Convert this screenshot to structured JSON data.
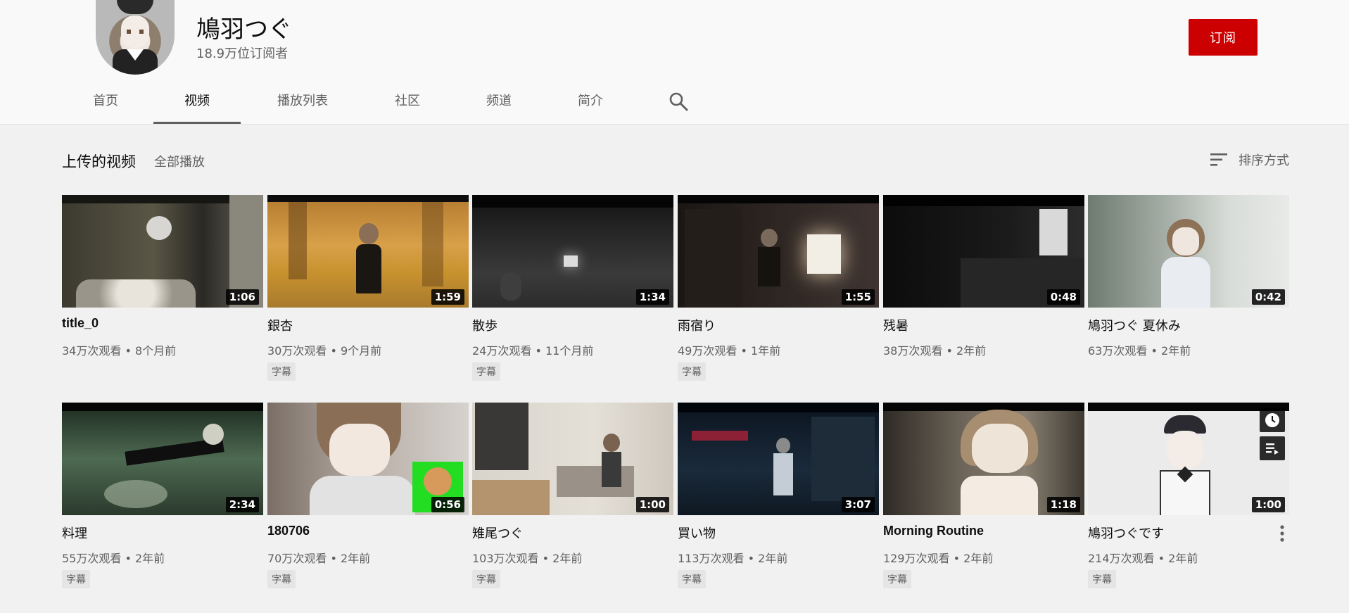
{
  "channel": {
    "name": "鳩羽つぐ",
    "subscribers": "18.9万位订阅者",
    "subscribe_label": "订阅"
  },
  "tabs": [
    {
      "label": "首页"
    },
    {
      "label": "视频"
    },
    {
      "label": "播放列表"
    },
    {
      "label": "社区"
    },
    {
      "label": "频道"
    },
    {
      "label": "简介"
    }
  ],
  "section": {
    "title": "上传的视频",
    "play_all": "全部播放",
    "sort_label": "排序方式"
  },
  "videos": [
    {
      "title": "title_0",
      "meta": "34万次观看 • 8个月前",
      "duration": "1:06",
      "badge": ""
    },
    {
      "title": "銀杏",
      "meta": "30万次观看 • 9个月前",
      "duration": "1:59",
      "badge": "字幕"
    },
    {
      "title": "散歩",
      "meta": "24万次观看 • 11个月前",
      "duration": "1:34",
      "badge": "字幕"
    },
    {
      "title": "雨宿り",
      "meta": "49万次观看 • 1年前",
      "duration": "1:55",
      "badge": "字幕"
    },
    {
      "title": "残暑",
      "meta": "38万次观看 • 2年前",
      "duration": "0:48",
      "badge": ""
    },
    {
      "title": "鳩羽つぐ 夏休み",
      "meta": "63万次观看 • 2年前",
      "duration": "0:42",
      "badge": ""
    },
    {
      "title": "料理",
      "meta": "55万次观看 • 2年前",
      "duration": "2:34",
      "badge": "字幕"
    },
    {
      "title": "180706",
      "meta": "70万次观看 • 2年前",
      "duration": "0:56",
      "badge": "字幕"
    },
    {
      "title": "雉尾つぐ",
      "meta": "103万次观看 • 2年前",
      "duration": "1:00",
      "badge": "字幕"
    },
    {
      "title": "買い物",
      "meta": "113万次观看 • 2年前",
      "duration": "3:07",
      "badge": "字幕"
    },
    {
      "title": "Morning Routine",
      "meta": "129万次观看 • 2年前",
      "duration": "1:18",
      "badge": "字幕"
    },
    {
      "title": "鳩羽つぐです",
      "meta": "214万次观看 • 2年前",
      "duration": "1:00",
      "badge": "字幕"
    }
  ],
  "icons": {
    "search": "search-icon",
    "sort": "sort-icon",
    "watch_later": "clock-icon",
    "add_to_queue": "queue-icon",
    "more": "more-vert-icon"
  },
  "colors": {
    "subscribe": "#cc0000",
    "page_bg": "#f1f1f1",
    "header_bg": "#f9f9f9"
  }
}
